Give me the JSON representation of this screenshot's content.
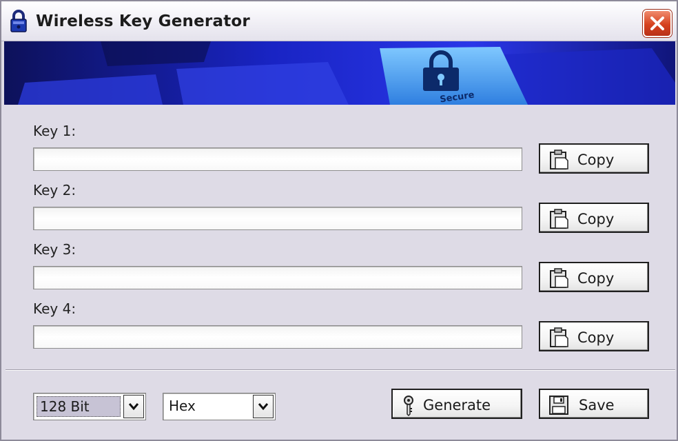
{
  "window": {
    "title": "Wireless Key Generator"
  },
  "banner": {
    "key_text": "Secure"
  },
  "keys": [
    {
      "label": "Key 1:",
      "value": "",
      "copy_label": "Copy"
    },
    {
      "label": "Key 2:",
      "value": "",
      "copy_label": "Copy"
    },
    {
      "label": "Key 3:",
      "value": "",
      "copy_label": "Copy"
    },
    {
      "label": "Key 4:",
      "value": "",
      "copy_label": "Copy"
    }
  ],
  "bottom": {
    "bit_length": "128 Bit",
    "format": "Hex",
    "generate_label": "Generate",
    "save_label": "Save"
  },
  "icons": {
    "title": "padlock-icon",
    "close": "close-icon",
    "copy": "clipboard-icon",
    "generate": "key-icon",
    "save": "floppy-disk-icon",
    "dropdown": "chevron-down-icon"
  },
  "colors": {
    "window_bg": "#dedbe6",
    "banner_blue": "#1a22c9",
    "close_red": "#d6421f"
  }
}
